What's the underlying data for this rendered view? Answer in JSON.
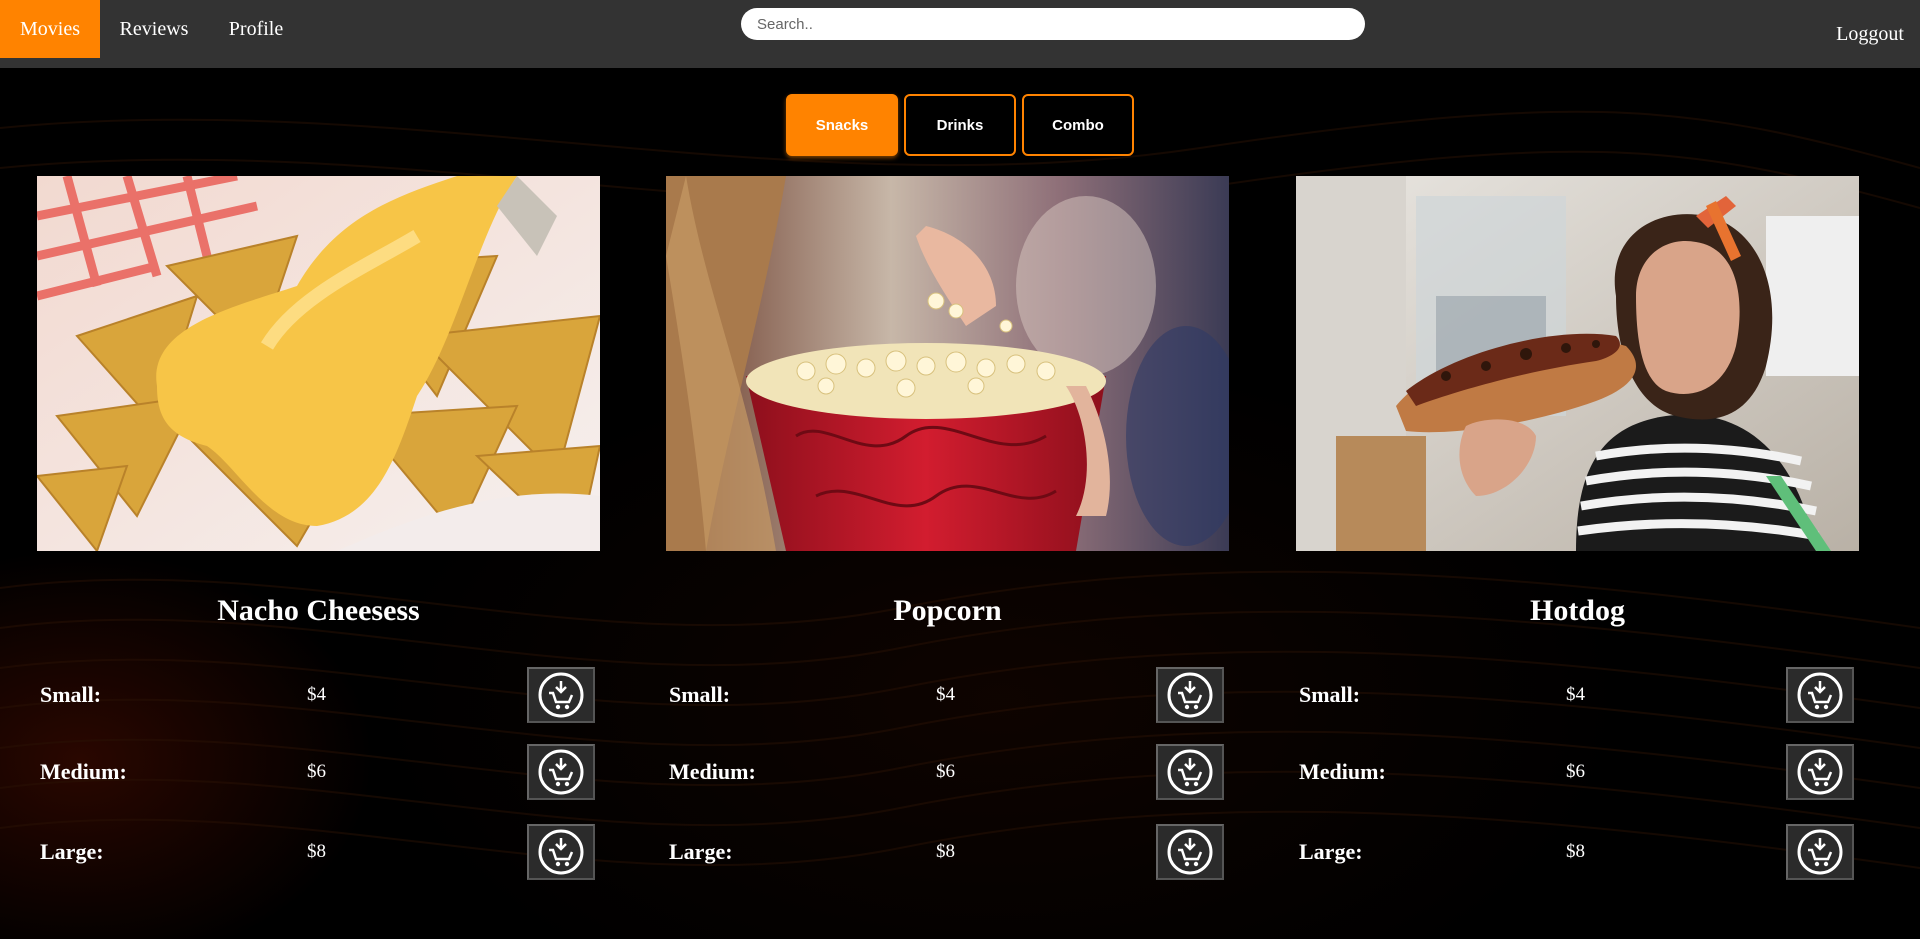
{
  "nav": {
    "movies": "Movies",
    "reviews": "Reviews",
    "profile": "Profile",
    "logout": "Loggout"
  },
  "search": {
    "placeholder": "Search..",
    "value": ""
  },
  "tabs": {
    "snacks": "Snacks",
    "drinks": "Drinks",
    "combo": "Combo"
  },
  "colors": {
    "accent": "#ff8300",
    "navbar": "#333333",
    "background": "#000000"
  },
  "products": [
    {
      "name": "Nacho Cheesess",
      "image": "nachos-with-cheese-photo",
      "sizes": [
        {
          "label": "Small:",
          "price": "$4"
        },
        {
          "label": "Medium:",
          "price": "$6"
        },
        {
          "label": "Large:",
          "price": "$8"
        }
      ]
    },
    {
      "name": "Popcorn",
      "image": "popcorn-bucket-photo",
      "sizes": [
        {
          "label": "Small:",
          "price": "$4"
        },
        {
          "label": "Medium:",
          "price": "$6"
        },
        {
          "label": "Large:",
          "price": "$8"
        }
      ]
    },
    {
      "name": "Hotdog",
      "image": "woman-eating-hotdog-photo",
      "sizes": [
        {
          "label": "Small:",
          "price": "$4"
        },
        {
          "label": "Medium:",
          "price": "$6"
        },
        {
          "label": "Large:",
          "price": "$8"
        }
      ]
    }
  ],
  "icons": {
    "cart": "add-to-cart-icon"
  }
}
